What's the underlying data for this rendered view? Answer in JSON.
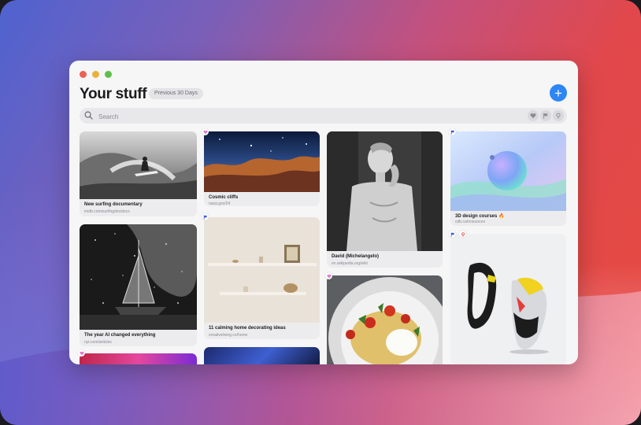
{
  "window": {
    "title": "Your stuff",
    "range_pill": "Previous 30 Days",
    "add_label": "+"
  },
  "search": {
    "placeholder": "Search"
  },
  "filters": [
    "heart-icon",
    "flag-icon",
    "pin-icon"
  ],
  "cards": {
    "surf": {
      "title": "New surfing documentary",
      "url": "imdb.com/surfingdocidocs"
    },
    "cosmic": {
      "title": "Cosmic cliffs",
      "url": "nasa.gov/24"
    },
    "david": {
      "title": "David (Michelangelo)",
      "url": "en.wikipedia.org/wiki"
    },
    "design": {
      "title": "3D design courses 🔥",
      "url": "cdb.ca/resources"
    },
    "ai": {
      "title": "The year AI changed everything",
      "url": "nyt.com/articles"
    },
    "home": {
      "title": "11 calming home decorating ideas",
      "url": "creativeliving.co/home"
    }
  },
  "colors": {
    "accent": "#2e86f5",
    "heart_badge": "#e07ad1",
    "flag_badge": "#3b5bd8",
    "pin_badge": "#e34a4a"
  }
}
